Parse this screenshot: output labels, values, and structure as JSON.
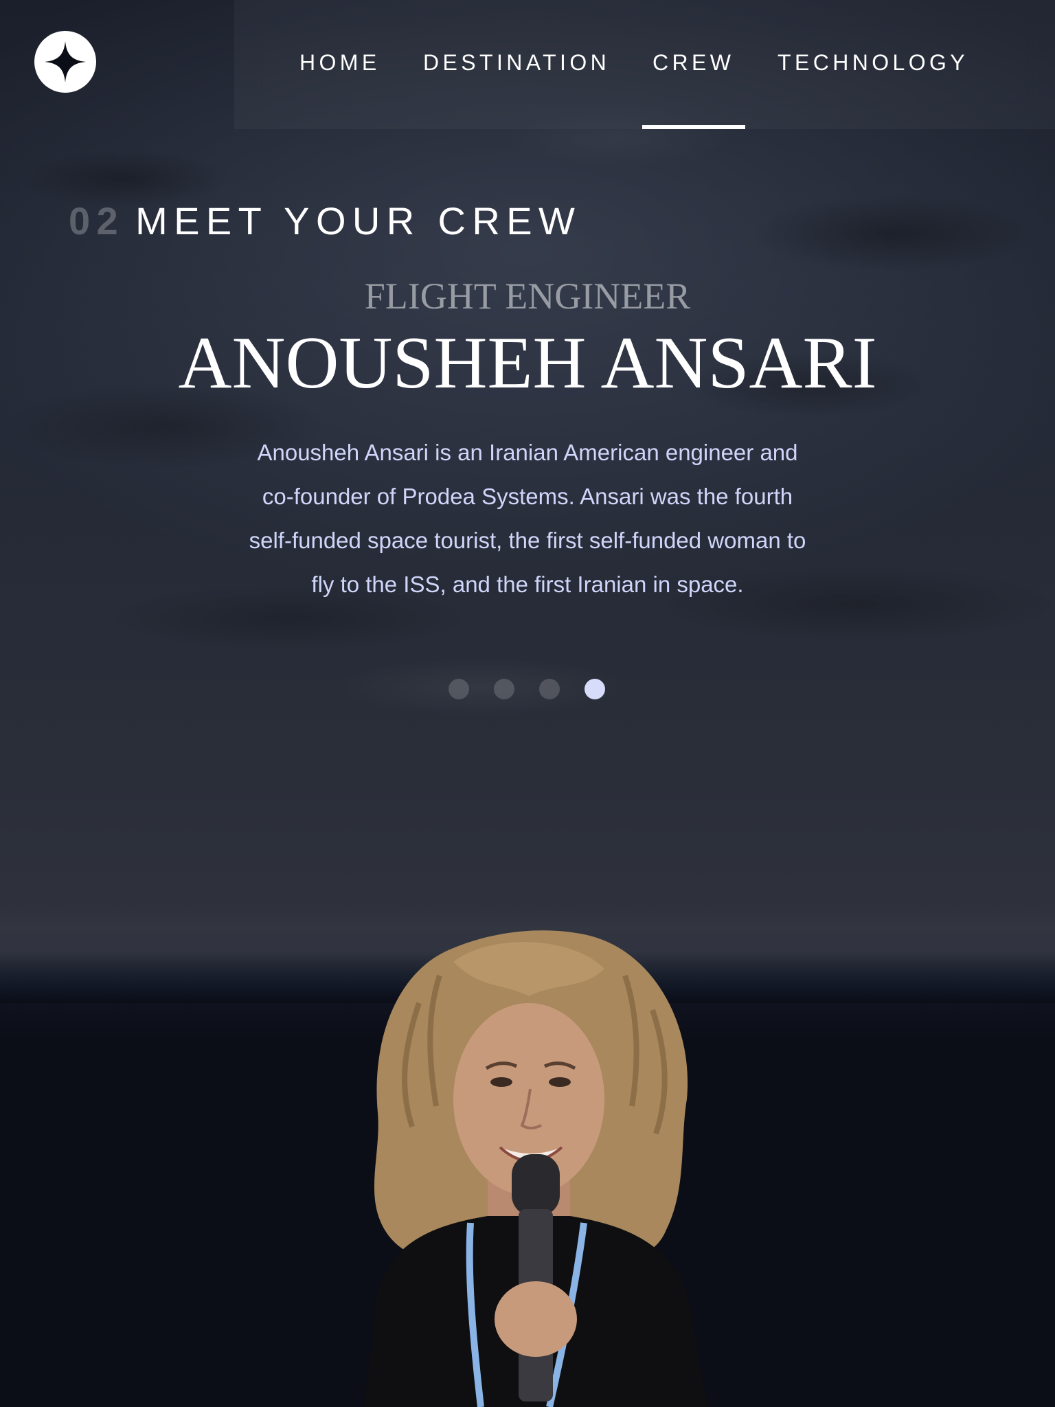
{
  "header": {
    "logo_icon": "star-logo-icon",
    "nav": [
      {
        "num": "",
        "label": "HOME"
      },
      {
        "num": "",
        "label": "DESTINATION"
      },
      {
        "num": "",
        "label": "CREW",
        "active": true
      },
      {
        "num": "",
        "label": "TECHNOLOGY"
      }
    ]
  },
  "main": {
    "section_number": "02",
    "section_title": "MEET YOUR CREW",
    "role": "FLIGHT ENGINEER",
    "name": "ANOUSHEH ANSARI",
    "bio": "Anousheh Ansari is an Iranian American engineer and co-founder of Prodea Systems. Ansari was the fourth self-funded space tourist, the first self-funded woman to fly to the ISS, and the first Iranian in space.",
    "slider": {
      "count": 4,
      "active_index": 3
    },
    "portrait_icon": "crew-portrait-image"
  },
  "colors": {
    "background": "#0b0d17",
    "text_primary": "#ffffff",
    "text_secondary": "#d0d6f9",
    "dot_active": "#d8dcfb"
  }
}
